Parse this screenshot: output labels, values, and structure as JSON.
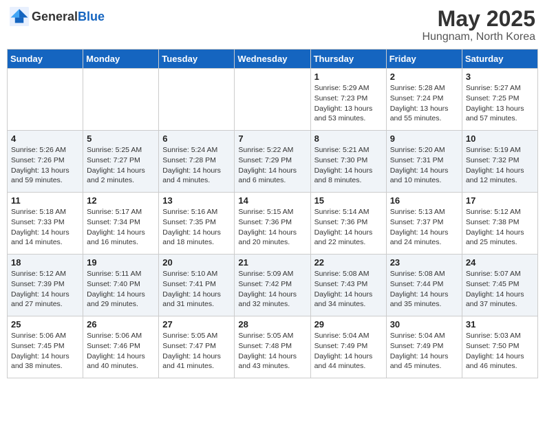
{
  "header": {
    "logo_general": "General",
    "logo_blue": "Blue",
    "month_title": "May 2025",
    "location": "Hungnam, North Korea"
  },
  "days_of_week": [
    "Sunday",
    "Monday",
    "Tuesday",
    "Wednesday",
    "Thursday",
    "Friday",
    "Saturday"
  ],
  "weeks": [
    [
      {
        "day": "",
        "detail": ""
      },
      {
        "day": "",
        "detail": ""
      },
      {
        "day": "",
        "detail": ""
      },
      {
        "day": "",
        "detail": ""
      },
      {
        "day": "1",
        "detail": "Sunrise: 5:29 AM\nSunset: 7:23 PM\nDaylight: 13 hours\nand 53 minutes."
      },
      {
        "day": "2",
        "detail": "Sunrise: 5:28 AM\nSunset: 7:24 PM\nDaylight: 13 hours\nand 55 minutes."
      },
      {
        "day": "3",
        "detail": "Sunrise: 5:27 AM\nSunset: 7:25 PM\nDaylight: 13 hours\nand 57 minutes."
      }
    ],
    [
      {
        "day": "4",
        "detail": "Sunrise: 5:26 AM\nSunset: 7:26 PM\nDaylight: 13 hours\nand 59 minutes."
      },
      {
        "day": "5",
        "detail": "Sunrise: 5:25 AM\nSunset: 7:27 PM\nDaylight: 14 hours\nand 2 minutes."
      },
      {
        "day": "6",
        "detail": "Sunrise: 5:24 AM\nSunset: 7:28 PM\nDaylight: 14 hours\nand 4 minutes."
      },
      {
        "day": "7",
        "detail": "Sunrise: 5:22 AM\nSunset: 7:29 PM\nDaylight: 14 hours\nand 6 minutes."
      },
      {
        "day": "8",
        "detail": "Sunrise: 5:21 AM\nSunset: 7:30 PM\nDaylight: 14 hours\nand 8 minutes."
      },
      {
        "day": "9",
        "detail": "Sunrise: 5:20 AM\nSunset: 7:31 PM\nDaylight: 14 hours\nand 10 minutes."
      },
      {
        "day": "10",
        "detail": "Sunrise: 5:19 AM\nSunset: 7:32 PM\nDaylight: 14 hours\nand 12 minutes."
      }
    ],
    [
      {
        "day": "11",
        "detail": "Sunrise: 5:18 AM\nSunset: 7:33 PM\nDaylight: 14 hours\nand 14 minutes."
      },
      {
        "day": "12",
        "detail": "Sunrise: 5:17 AM\nSunset: 7:34 PM\nDaylight: 14 hours\nand 16 minutes."
      },
      {
        "day": "13",
        "detail": "Sunrise: 5:16 AM\nSunset: 7:35 PM\nDaylight: 14 hours\nand 18 minutes."
      },
      {
        "day": "14",
        "detail": "Sunrise: 5:15 AM\nSunset: 7:36 PM\nDaylight: 14 hours\nand 20 minutes."
      },
      {
        "day": "15",
        "detail": "Sunrise: 5:14 AM\nSunset: 7:36 PM\nDaylight: 14 hours\nand 22 minutes."
      },
      {
        "day": "16",
        "detail": "Sunrise: 5:13 AM\nSunset: 7:37 PM\nDaylight: 14 hours\nand 24 minutes."
      },
      {
        "day": "17",
        "detail": "Sunrise: 5:12 AM\nSunset: 7:38 PM\nDaylight: 14 hours\nand 25 minutes."
      }
    ],
    [
      {
        "day": "18",
        "detail": "Sunrise: 5:12 AM\nSunset: 7:39 PM\nDaylight: 14 hours\nand 27 minutes."
      },
      {
        "day": "19",
        "detail": "Sunrise: 5:11 AM\nSunset: 7:40 PM\nDaylight: 14 hours\nand 29 minutes."
      },
      {
        "day": "20",
        "detail": "Sunrise: 5:10 AM\nSunset: 7:41 PM\nDaylight: 14 hours\nand 31 minutes."
      },
      {
        "day": "21",
        "detail": "Sunrise: 5:09 AM\nSunset: 7:42 PM\nDaylight: 14 hours\nand 32 minutes."
      },
      {
        "day": "22",
        "detail": "Sunrise: 5:08 AM\nSunset: 7:43 PM\nDaylight: 14 hours\nand 34 minutes."
      },
      {
        "day": "23",
        "detail": "Sunrise: 5:08 AM\nSunset: 7:44 PM\nDaylight: 14 hours\nand 35 minutes."
      },
      {
        "day": "24",
        "detail": "Sunrise: 5:07 AM\nSunset: 7:45 PM\nDaylight: 14 hours\nand 37 minutes."
      }
    ],
    [
      {
        "day": "25",
        "detail": "Sunrise: 5:06 AM\nSunset: 7:45 PM\nDaylight: 14 hours\nand 38 minutes."
      },
      {
        "day": "26",
        "detail": "Sunrise: 5:06 AM\nSunset: 7:46 PM\nDaylight: 14 hours\nand 40 minutes."
      },
      {
        "day": "27",
        "detail": "Sunrise: 5:05 AM\nSunset: 7:47 PM\nDaylight: 14 hours\nand 41 minutes."
      },
      {
        "day": "28",
        "detail": "Sunrise: 5:05 AM\nSunset: 7:48 PM\nDaylight: 14 hours\nand 43 minutes."
      },
      {
        "day": "29",
        "detail": "Sunrise: 5:04 AM\nSunset: 7:49 PM\nDaylight: 14 hours\nand 44 minutes."
      },
      {
        "day": "30",
        "detail": "Sunrise: 5:04 AM\nSunset: 7:49 PM\nDaylight: 14 hours\nand 45 minutes."
      },
      {
        "day": "31",
        "detail": "Sunrise: 5:03 AM\nSunset: 7:50 PM\nDaylight: 14 hours\nand 46 minutes."
      }
    ]
  ]
}
